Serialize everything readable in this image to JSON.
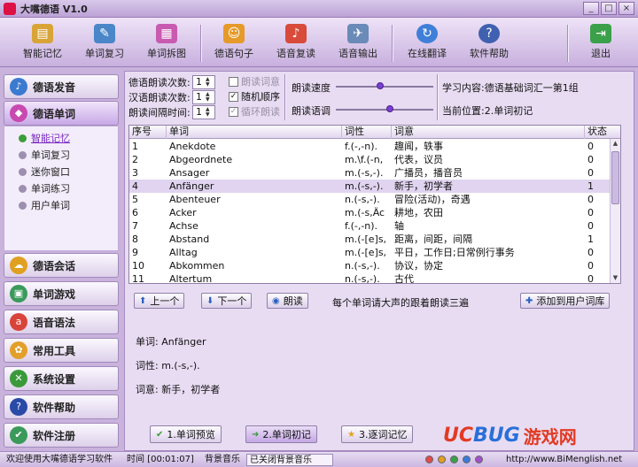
{
  "window": {
    "title": "大嘴德语 V1.0",
    "buttons": [
      "_",
      "□",
      "×"
    ]
  },
  "toolbar": {
    "items": [
      {
        "label": "智能记忆",
        "icon": "book-icon",
        "color": "#d8a437"
      },
      {
        "label": "单词复习",
        "icon": "notebook-icon",
        "color": "#4a86c8"
      },
      {
        "label": "单词拆图",
        "icon": "grid-icon",
        "color": "#c85ab0"
      },
      {
        "label": "德语句子",
        "icon": "people-icon",
        "color": "#e59a2a"
      },
      {
        "label": "语音复读",
        "icon": "speaker-person-icon",
        "color": "#d84a3a"
      },
      {
        "label": "语音输出",
        "icon": "satellite-icon",
        "color": "#6a8ab8"
      },
      {
        "label": "在线翻译",
        "icon": "globe-refresh-icon",
        "color": "#3f7fd8"
      },
      {
        "label": "软件帮助",
        "icon": "help-icon",
        "color": "#4060b0"
      },
      {
        "label": "退出",
        "icon": "exit-door-icon",
        "color": "#3aa04a"
      }
    ]
  },
  "nav": {
    "items": [
      {
        "label": "德语发音",
        "icon": "pronunciation-icon",
        "color": "#3b7ad0"
      },
      {
        "label": "德语单词",
        "icon": "words-icon",
        "color": "#c84ab0",
        "active": true
      },
      {
        "label": "德语会话",
        "icon": "conversation-icon",
        "color": "#e0a020"
      },
      {
        "label": "单词游戏",
        "icon": "game-icon",
        "color": "#3a9a5a"
      },
      {
        "label": "语音语法",
        "icon": "abc-icon",
        "color": "#d8443a"
      },
      {
        "label": "常用工具",
        "icon": "tools-icon",
        "color": "#e2a02a"
      },
      {
        "label": "系统设置",
        "icon": "settings-icon",
        "color": "#3a9a3a"
      },
      {
        "label": "软件帮助",
        "icon": "help-icon",
        "color": "#2a4aa8"
      },
      {
        "label": "软件注册",
        "icon": "register-icon",
        "color": "#3a9a5a"
      }
    ],
    "subitems": [
      {
        "label": "智能记忆",
        "current": true
      },
      {
        "label": "单词复习"
      },
      {
        "label": "迷你窗口"
      },
      {
        "label": "单词练习"
      },
      {
        "label": "用户单词"
      }
    ]
  },
  "settings": {
    "german_reads_label": "德语朗读次数:",
    "german_reads_value": "1",
    "chinese_reads_label": "汉语朗读次数:",
    "chinese_reads_value": "1",
    "interval_label": "朗读间隔时间:",
    "interval_value": "1",
    "chk_read_meaning": "朗读词意",
    "chk_random": "随机顺序",
    "chk_loop": "循环朗读",
    "speed_label": "朗读速度",
    "speed_level": 0.45,
    "tone_label": "朗读语调",
    "tone_level": 0.55,
    "study_content": "学习内容:德语基础词汇一第1组",
    "current_position": "当前位置:2.单词初记"
  },
  "table": {
    "headers": [
      "序号",
      "单词",
      "词性",
      "词意",
      "状态"
    ],
    "rows": [
      {
        "no": "1",
        "word": "Anekdote",
        "pos": "f.(-,-n).",
        "meaning": "趣闻，轶事",
        "status": "0"
      },
      {
        "no": "2",
        "word": "Abgeordnete",
        "pos": "m.\\f.(-n,",
        "meaning": "代表，议员",
        "status": "0"
      },
      {
        "no": "3",
        "word": "Ansager",
        "pos": "m.(-s,-).",
        "meaning": "广播员，播音员",
        "status": "0"
      },
      {
        "no": "4",
        "word": "Anfänger",
        "pos": "m.(-s,-).",
        "meaning": "新手，初学者",
        "status": "1",
        "selected": true
      },
      {
        "no": "5",
        "word": "Abenteuer",
        "pos": "n.(-s,-).",
        "meaning": "冒险(活动)，奇遇",
        "status": "0"
      },
      {
        "no": "6",
        "word": "Acker",
        "pos": "m.(-s,Äc",
        "meaning": "耕地，农田",
        "status": "0"
      },
      {
        "no": "7",
        "word": "Achse",
        "pos": "f.(-,-n).",
        "meaning": "轴",
        "status": "0"
      },
      {
        "no": "8",
        "word": "Abstand",
        "pos": "m.(-[e]s,",
        "meaning": "距离，间距，间隔",
        "status": "1"
      },
      {
        "no": "9",
        "word": "Alltag",
        "pos": "m.(-[e]s,",
        "meaning": "平日，工作日;日常例行事务",
        "status": "0"
      },
      {
        "no": "10",
        "word": "Abkommen",
        "pos": "n.(-s,-).",
        "meaning": "协议，协定",
        "status": "0"
      },
      {
        "no": "11",
        "word": "Altertum",
        "pos": "n.(-s,-).",
        "meaning": "古代",
        "status": "0"
      }
    ]
  },
  "actions": {
    "prev": "上一个",
    "next": "下一个",
    "read": "朗读",
    "hint": "每个单词请大声的跟着朗读三遍",
    "add_user": "添加到用户词库"
  },
  "detail": {
    "word_line": "单词: Anfänger",
    "pos_line": "词性: m.(-s,-).",
    "meaning_line": "词意: 新手，初学者"
  },
  "steps": {
    "preview": "1.单词预览",
    "initial": "2.单词初记",
    "review": "3.逐词记忆"
  },
  "status": {
    "welcome": "欢迎使用大嘴德语学习软件",
    "time": "时间 [00:01:07]",
    "music_label": "背景音乐",
    "music_state": "已关闭背景音乐",
    "colors": [
      "#e04a4a",
      "#e0a020",
      "#3aa04a",
      "#3a7ad8",
      "#a050c8"
    ],
    "website": "http://www.BiMenglish.net"
  },
  "watermark": {
    "logo_a": "UC",
    "logo_b": "BUG",
    "cn": "游戏网"
  }
}
